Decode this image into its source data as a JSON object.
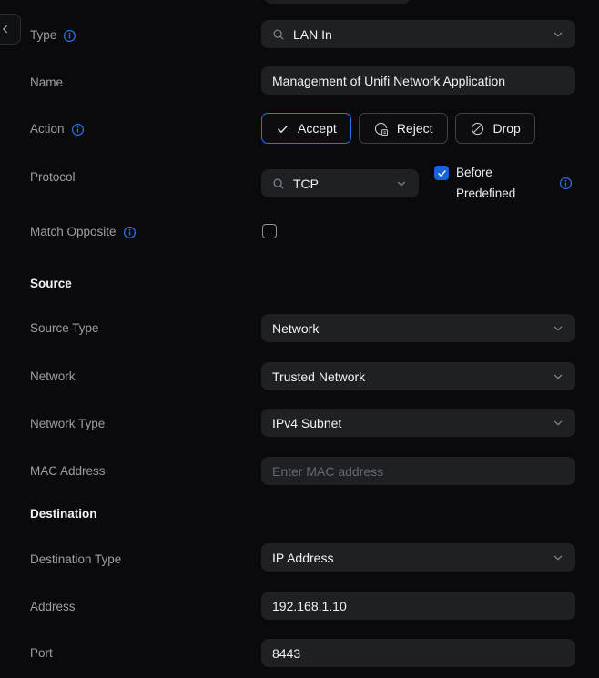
{
  "colors": {
    "accent_blue": "#2d72ea",
    "checkbox_blue": "#1665d8",
    "field_background": "#1e2023",
    "page_background": "#0a0a0c"
  },
  "form": {
    "type": {
      "label": "Type",
      "value": "LAN In"
    },
    "name": {
      "label": "Name",
      "value": "Management of Unifi Network Application"
    },
    "action": {
      "label": "Action",
      "options": [
        {
          "label": "Accept",
          "icon": "check-icon",
          "selected": true
        },
        {
          "label": "Reject",
          "icon": "reject-icon",
          "selected": false
        },
        {
          "label": "Drop",
          "icon": "circle-slash-icon",
          "selected": false
        }
      ]
    },
    "protocol": {
      "label": "Protocol",
      "value": "TCP",
      "checkbox_line1": "Before",
      "checkbox_line2": "Predefined",
      "checkbox_checked": true
    },
    "match_opposite": {
      "label": "Match Opposite",
      "checked": false
    },
    "source_section": {
      "title": "Source"
    },
    "source_type": {
      "label": "Source Type",
      "value": "Network"
    },
    "network": {
      "label": "Network",
      "value": "Trusted Network"
    },
    "network_type": {
      "label": "Network Type",
      "value": "IPv4 Subnet"
    },
    "mac_address": {
      "label": "MAC Address",
      "placeholder": "Enter MAC address"
    },
    "destination_section": {
      "title": "Destination"
    },
    "destination_type": {
      "label": "Destination Type",
      "value": "IP Address"
    },
    "address": {
      "label": "Address",
      "value": "192.168.1.10"
    },
    "port": {
      "label": "Port",
      "value": "8443"
    }
  }
}
